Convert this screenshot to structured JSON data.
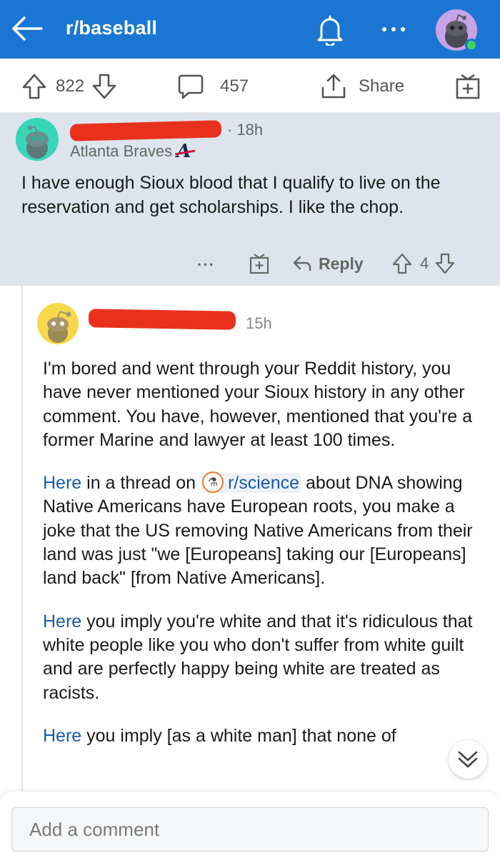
{
  "header": {
    "subreddit": "r/baseball",
    "colors": {
      "bar": "#1a76d2",
      "online": "#46d160"
    }
  },
  "post_actions": {
    "upvotes": "822",
    "comments": "457",
    "share_label": "Share"
  },
  "parent_comment": {
    "time": "· 18h",
    "flair": "Atlanta Braves",
    "flair_logo": "A",
    "body": "I have enough Sioux blood that I qualify to live on the reservation and get scholarships. I like the chop.",
    "actions": {
      "more": "···",
      "reply_label": "Reply",
      "score": "4"
    }
  },
  "child_comment": {
    "time": "15h",
    "paragraph1": "I'm bored and went through your Reddit history, you have never mentioned your Sioux history in any other comment. You have, however, mentioned that you're a former Marine and lawyer at least 100 times.",
    "paragraph2": {
      "link": "Here",
      "pre": " in a thread on ",
      "subreddit": "r/science",
      "post": " about DNA showing Native Americans have European roots, you make a joke that the US removing Native Americans from their land was just \"we [Europeans] taking our [Europeans] land back\" [from Native Americans]."
    },
    "paragraph3": {
      "link": "Here",
      "text": " you imply you're white and that it's ridiculous that white people like you who don't suffer from white guilt and are perfectly happy being white are treated as racists."
    },
    "paragraph4": {
      "link": "Here",
      "text": " you imply [as a white man] that none of"
    }
  },
  "composer": {
    "placeholder": "Add a comment"
  }
}
